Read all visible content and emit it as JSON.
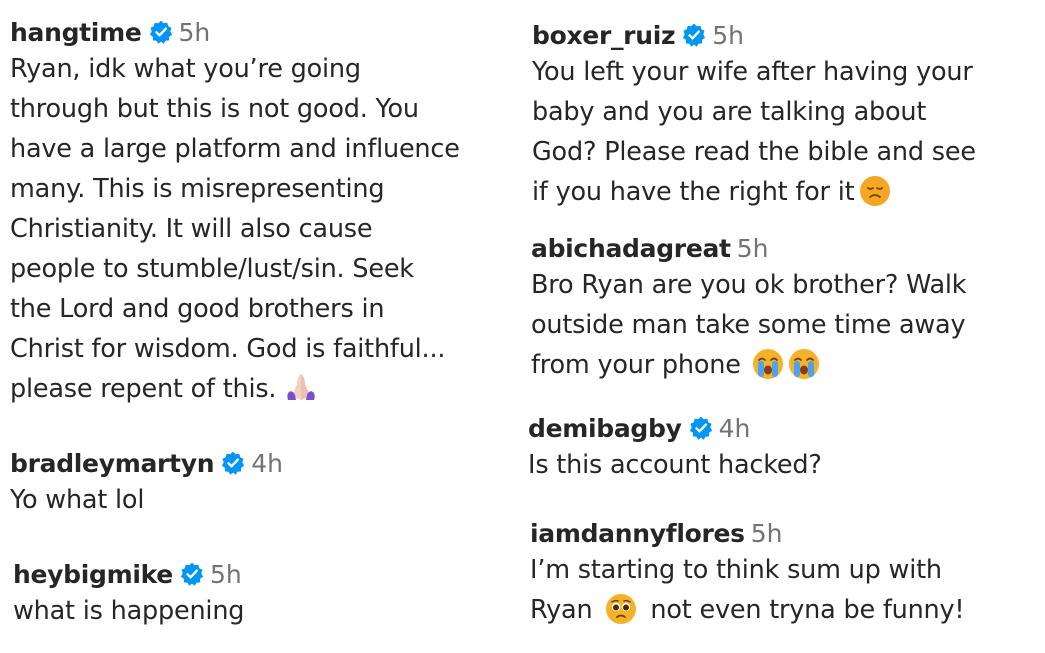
{
  "comments": {
    "hangtime": {
      "username": "hangtime",
      "verified": true,
      "time": "5h",
      "lines": [
        "Ryan, idk what you’re going",
        "through but this is not good. You",
        "have a large platform and influence",
        "many. This is misrepresenting",
        "Christianity. It will also cause",
        "people to stumble/lust/sin. Seek",
        "the Lord and good brothers in",
        "Christ for wisdom. God is faithful...",
        "please repent of this."
      ],
      "emoji": "folded-hands-icon"
    },
    "bradleymartyn": {
      "username": "bradleymartyn",
      "verified": true,
      "time": "4h",
      "lines": [
        "Yo what lol"
      ]
    },
    "heybigmike": {
      "username": "heybigmike",
      "verified": true,
      "time": "5h",
      "lines": [
        "what is happening"
      ]
    },
    "boxer_ruiz": {
      "username": "boxer_ruiz",
      "verified": true,
      "time": "5h",
      "lines": [
        "You left your wife after having your",
        "baby and you are talking about",
        "God? Please read the bible and see",
        "if you have the right for it"
      ],
      "emoji": "disappointed-face-icon"
    },
    "abichadagreat": {
      "username": "abichadagreat",
      "verified": false,
      "time": "5h",
      "lines": [
        "Bro Ryan are you ok brother? Walk",
        "outside man take some time away",
        "from your phone"
      ],
      "emoji": "loudly-crying-face-icon"
    },
    "demibagby": {
      "username": "demibagby",
      "verified": true,
      "time": "4h",
      "lines": [
        "Is this account hacked?"
      ]
    },
    "iamdannyflores": {
      "username": "iamdannyflores",
      "verified": false,
      "time": "5h",
      "lines": [
        "I’m starting to think sum up with",
        "Ryan",
        "not even tryna be funny!"
      ],
      "emoji": "pleading-face-icon"
    }
  },
  "colors": {
    "text": "#262626",
    "muted": "#737373",
    "verified_blue": "#0095f6"
  }
}
